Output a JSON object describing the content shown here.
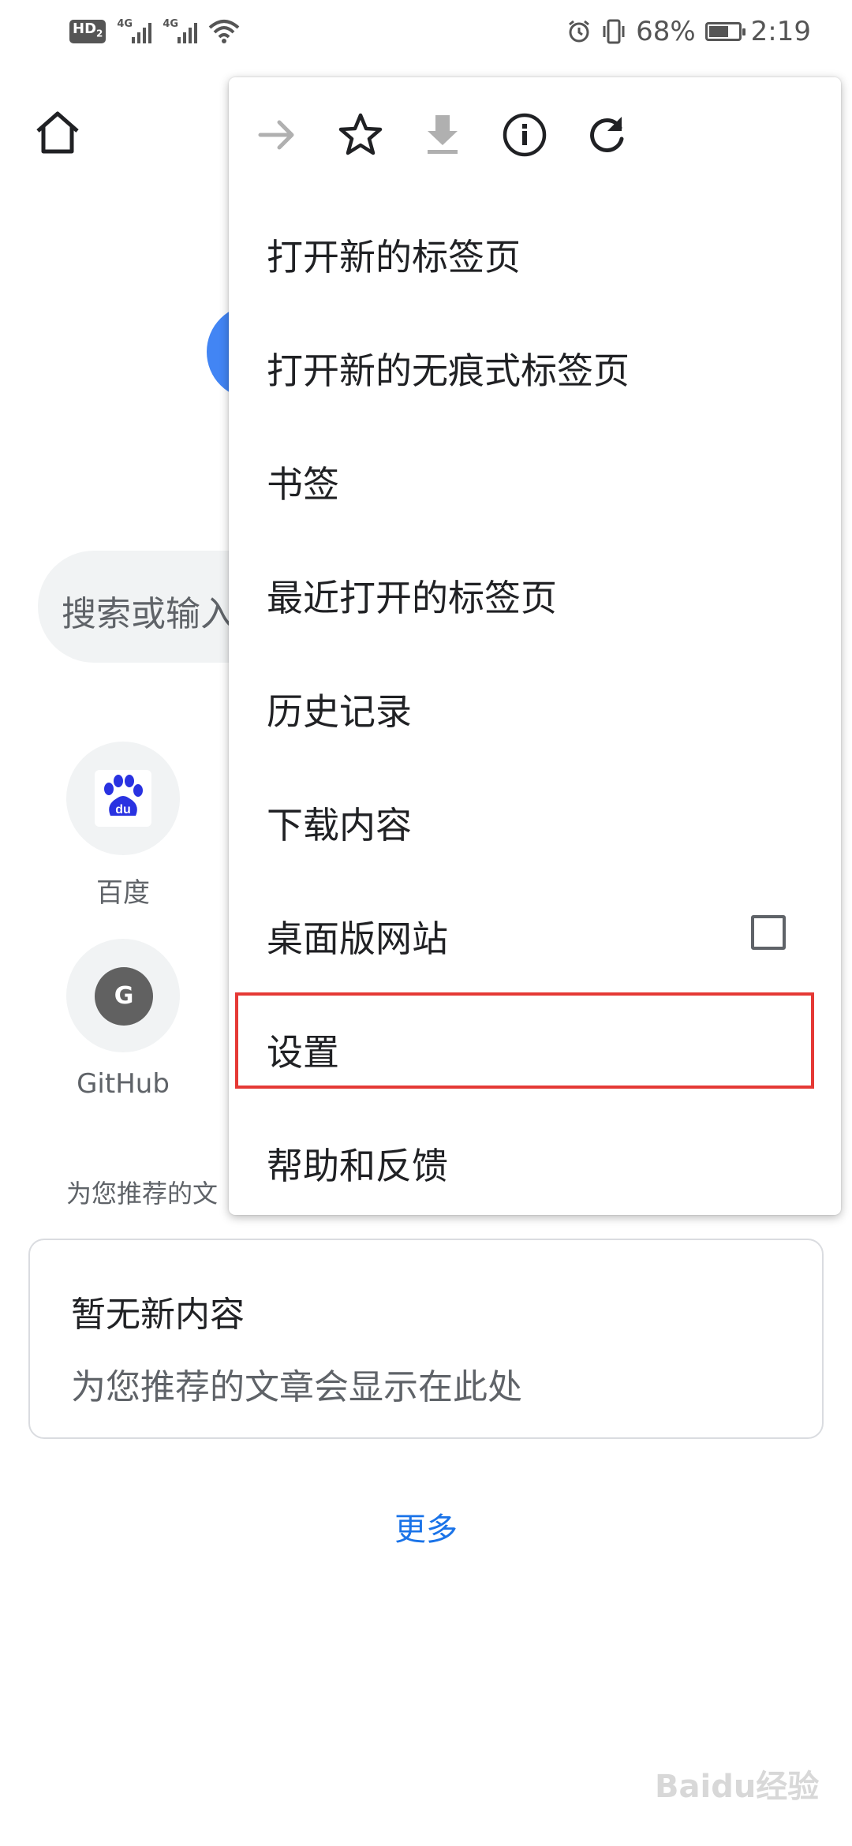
{
  "status_bar": {
    "hd_label": "HD",
    "hd_sub": "2",
    "signal1_label": "4G",
    "signal2_label": "4G",
    "battery_percent": "68%",
    "battery_level": 0.68,
    "time": "2:19"
  },
  "page": {
    "search_placeholder": "搜索或输入",
    "shortcuts": [
      {
        "label": "百度",
        "icon": "baidu-logo"
      },
      {
        "label": "GitHub",
        "icon": "github-letter",
        "letter": "G"
      }
    ],
    "recommend_heading": "为您推荐的文",
    "card": {
      "title": "暂无新内容",
      "subtitle": "为您推荐的文章会显示在此处"
    },
    "more_link": "更多"
  },
  "menu": {
    "toolbar_icons": [
      "forward-icon",
      "bookmark-star-icon",
      "download-icon",
      "info-icon",
      "reload-icon"
    ],
    "items": [
      {
        "label": "打开新的标签页"
      },
      {
        "label": "打开新的无痕式标签页"
      },
      {
        "label": "书签"
      },
      {
        "label": "最近打开的标签页"
      },
      {
        "label": "历史记录"
      },
      {
        "label": "下载内容"
      },
      {
        "label": "桌面版网站",
        "checkbox_checked": false
      },
      {
        "label": "设置",
        "highlighted": true
      },
      {
        "label": "帮助和反馈"
      }
    ]
  },
  "colors": {
    "highlight": "#e53935",
    "link": "#1a73e8",
    "google_blue": "#4285f4"
  },
  "watermark": {
    "text": "Baidu经验"
  }
}
